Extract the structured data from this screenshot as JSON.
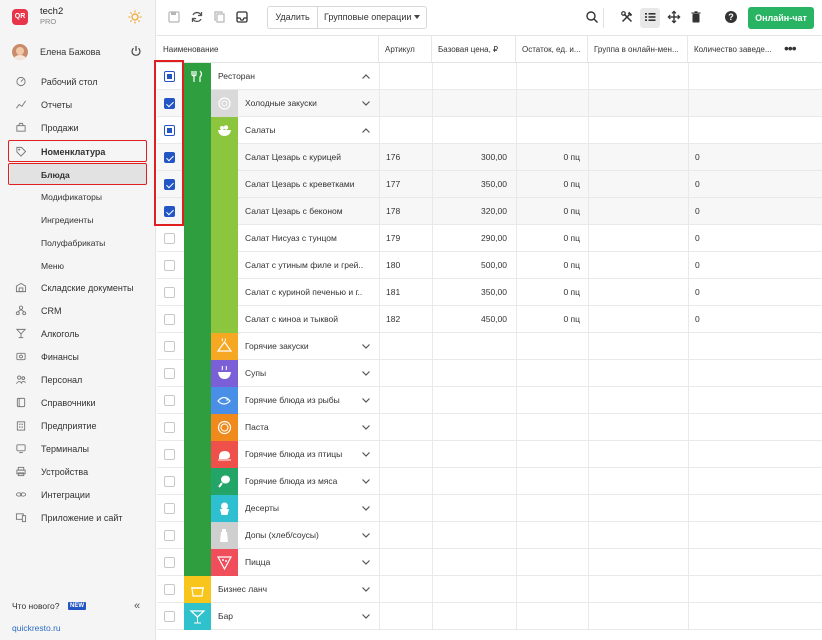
{
  "app": {
    "name": "tech2",
    "plan": "PRO",
    "logo_text": "QR"
  },
  "user": {
    "name": "Елена Бажова"
  },
  "sidebar": {
    "items": [
      {
        "label": "Рабочий стол",
        "icon": "dashboard-icon"
      },
      {
        "label": "Отчеты",
        "icon": "chart-icon"
      },
      {
        "label": "Продажи",
        "icon": "cart-icon"
      },
      {
        "label": "Номенклатура",
        "icon": "tag-icon",
        "highlighted": true
      },
      {
        "label": "Блюда",
        "highlighted": true,
        "active": true
      },
      {
        "label": "Модификаторы"
      },
      {
        "label": "Ингредиенты"
      },
      {
        "label": "Полуфабрикаты"
      },
      {
        "label": "Меню"
      },
      {
        "label": "Складские документы",
        "icon": "warehouse-icon"
      },
      {
        "label": "CRM",
        "icon": "crm-icon"
      },
      {
        "label": "Алкоголь",
        "icon": "cocktail-icon"
      },
      {
        "label": "Финансы",
        "icon": "finance-icon"
      },
      {
        "label": "Персонал",
        "icon": "people-icon"
      },
      {
        "label": "Справочники",
        "icon": "book-icon"
      },
      {
        "label": "Предприятие",
        "icon": "building-icon"
      },
      {
        "label": "Терминалы",
        "icon": "terminal-icon"
      },
      {
        "label": "Устройства",
        "icon": "printer-icon"
      },
      {
        "label": "Интеграции",
        "icon": "link-icon"
      },
      {
        "label": "Приложение и сайт",
        "icon": "devices-icon"
      }
    ],
    "whats_new": "Что нового?",
    "new_badge": "NEW",
    "site_link": "quickresto.ru"
  },
  "toolbar": {
    "delete_label": "Удалить",
    "group_ops_label": "Групповые операции",
    "chat_label": "Онлайн-чат"
  },
  "table": {
    "columns": [
      "Наименование",
      "Артикул",
      "Базовая цена, ₽",
      "Остаток, ед. и...",
      "Группа в онлайн-мен...",
      "Количество заведе..."
    ],
    "rows": [
      {
        "level": 0,
        "name": "Ресторан",
        "state": "partial",
        "expanded": true,
        "icon": "restaurant-icon"
      },
      {
        "level": 1,
        "name": "Холодные закуски",
        "state": "checked",
        "expanded": false,
        "icon": "cold-snacks-icon"
      },
      {
        "level": 1,
        "name": "Салаты",
        "state": "partial",
        "expanded": true,
        "icon": "salad-icon"
      },
      {
        "level": 2,
        "name": "Салат Цезарь с курицей",
        "state": "checked",
        "article": "176",
        "price": "300,00",
        "stock": "0 пц",
        "count": "0"
      },
      {
        "level": 2,
        "name": "Салат Цезарь с креветками",
        "state": "checked",
        "article": "177",
        "price": "350,00",
        "stock": "0 пц",
        "count": "0"
      },
      {
        "level": 2,
        "name": "Салат Цезарь с беконом",
        "state": "checked",
        "article": "178",
        "price": "320,00",
        "stock": "0 пц",
        "count": "0"
      },
      {
        "level": 2,
        "name": "Салат Нисуаз с тунцом",
        "state": "unchecked",
        "article": "179",
        "price": "290,00",
        "stock": "0 пц",
        "count": "0"
      },
      {
        "level": 2,
        "name": "Салат с утиным филе и грей...",
        "state": "unchecked",
        "article": "180",
        "price": "500,00",
        "stock": "0 пц",
        "count": "0"
      },
      {
        "level": 2,
        "name": "Салат с куриной печенью и г...",
        "state": "unchecked",
        "article": "181",
        "price": "350,00",
        "stock": "0 пц",
        "count": "0"
      },
      {
        "level": 2,
        "name": "Салат с киноа и тыквой",
        "state": "unchecked",
        "article": "182",
        "price": "450,00",
        "stock": "0 пц",
        "count": "0"
      },
      {
        "level": 1,
        "name": "Горячие закуски",
        "state": "unchecked",
        "expanded": false,
        "icon": "hot-snacks-icon"
      },
      {
        "level": 1,
        "name": "Супы",
        "state": "unchecked",
        "expanded": false,
        "icon": "soup-icon"
      },
      {
        "level": 1,
        "name": "Горячие блюда из рыбы",
        "state": "unchecked",
        "expanded": false,
        "icon": "fish-icon"
      },
      {
        "level": 1,
        "name": "Паста",
        "state": "unchecked",
        "expanded": false,
        "icon": "pasta-icon"
      },
      {
        "level": 1,
        "name": "Горячие блюда из птицы",
        "state": "unchecked",
        "expanded": false,
        "icon": "poultry-icon"
      },
      {
        "level": 1,
        "name": "Горячие блюда из мяса",
        "state": "unchecked",
        "expanded": false,
        "icon": "meat-icon"
      },
      {
        "level": 1,
        "name": "Десерты",
        "state": "unchecked",
        "expanded": false,
        "icon": "dessert-icon"
      },
      {
        "level": 1,
        "name": "Допы (хлеб/соусы)",
        "state": "unchecked",
        "expanded": false,
        "icon": "sauce-icon"
      },
      {
        "level": 1,
        "name": "Пицца",
        "state": "unchecked",
        "expanded": false,
        "icon": "pizza-icon"
      },
      {
        "level": 0,
        "name": "Бизнес ланч",
        "state": "unchecked",
        "expanded": false,
        "icon": "lunch-icon"
      },
      {
        "level": 0,
        "name": "Бар",
        "state": "unchecked",
        "expanded": false,
        "icon": "bar-icon"
      }
    ]
  },
  "colors": {
    "accent": "#2356c4",
    "highlight_red": "#e02020",
    "chat_green": "#28b463",
    "restaurant_green": "#2f9e3e",
    "salad_green": "#8cc63f"
  }
}
